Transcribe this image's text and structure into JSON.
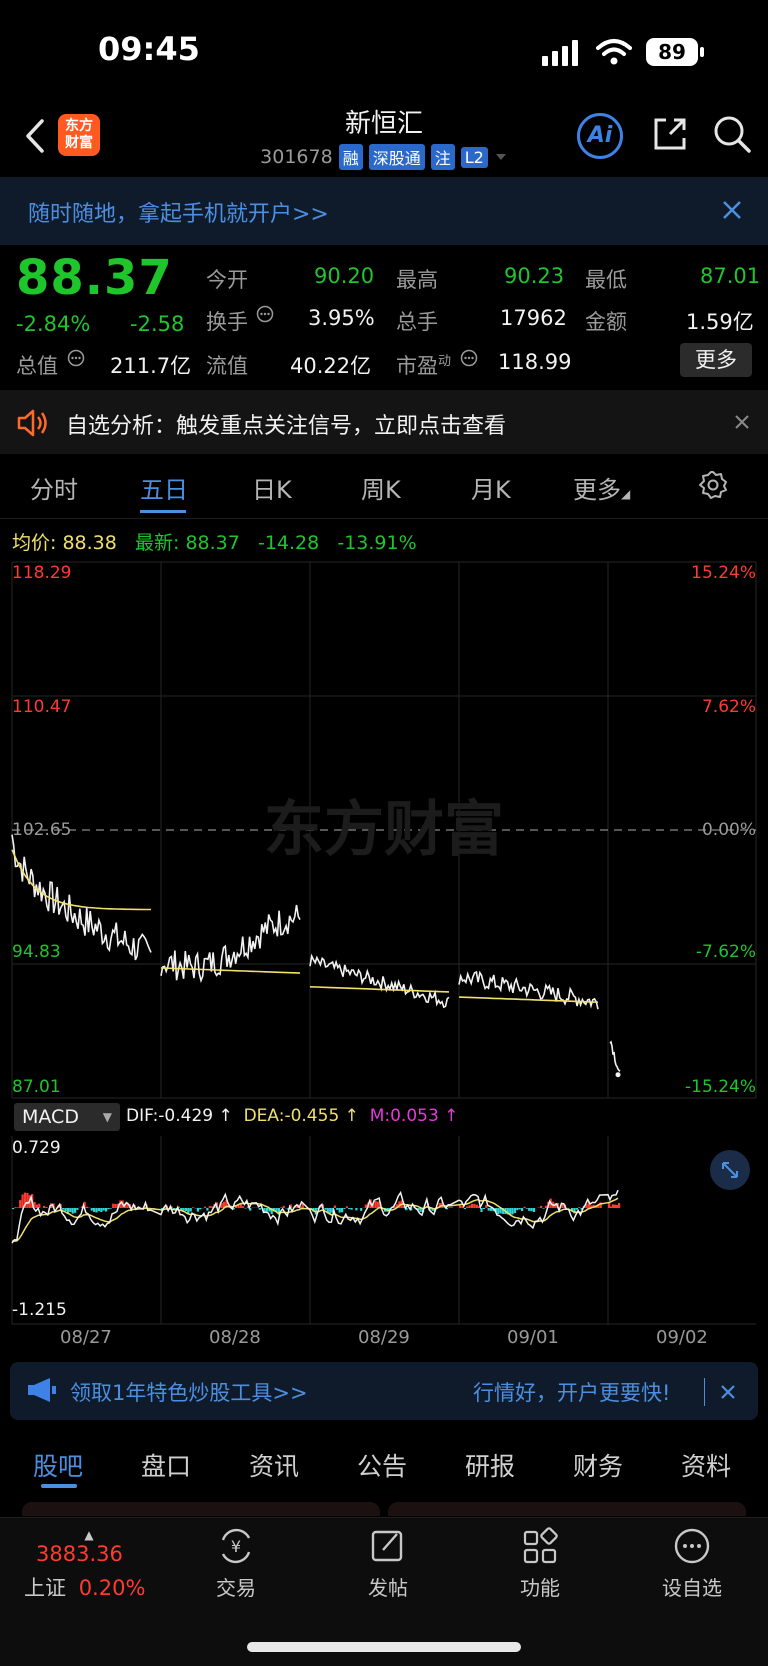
{
  "status": {
    "time": "09:45",
    "battery": "89"
  },
  "nav": {
    "logo_line1": "东方",
    "logo_line2": "财富",
    "stock_name": "新恒汇",
    "stock_code": "301678",
    "tags": [
      "融",
      "深股通",
      "注",
      "L2"
    ],
    "ai_label": "Ai"
  },
  "banner": {
    "text": "随时随地，拿起手机就开户>>"
  },
  "quote": {
    "price": "88.37",
    "change_pct": "-2.84%",
    "change_abs": "-2.58",
    "open_label": "今开",
    "open_value": "90.20",
    "high_label": "最高",
    "high_value": "90.23",
    "low_label": "最低",
    "low_value": "87.01",
    "turnover_label": "换手",
    "turnover_value": "3.95%",
    "volume_label": "总手",
    "volume_value": "17962",
    "amount_label": "金额",
    "amount_value": "1.59亿",
    "total_mv_label": "总值",
    "total_mv_value": "211.7亿",
    "float_mv_label": "流值",
    "float_mv_value": "40.22亿",
    "pe_label": "市盈",
    "pe_sup": "动",
    "pe_value": "118.99",
    "more_label": "更多"
  },
  "analysis": {
    "text": "自选分析：触发重点关注信号，立即点击查看"
  },
  "tabs": [
    "分时",
    "五日",
    "日K",
    "周K",
    "月K",
    "更多"
  ],
  "legend": {
    "avg_label": "均价:",
    "avg_value": "88.38",
    "latest_label": "最新:",
    "latest_value": "88.37",
    "change_abs": "-14.28",
    "change_pct": "-13.91%"
  },
  "chart": {
    "y_left": [
      "118.29",
      "110.47",
      "102.65",
      "94.83",
      "87.01"
    ],
    "y_right": [
      "15.24%",
      "7.62%",
      "0.00%",
      "-7.62%",
      "-15.24%"
    ],
    "watermark": "东方财富",
    "macd_label": "MACD",
    "dif": "DIF:-0.429 ↑",
    "dea": "DEA:-0.455 ↑",
    "m": "M:0.053 ↑",
    "macd_max": "0.729",
    "macd_min": "-1.215",
    "dates": [
      "08/27",
      "08/28",
      "08/29",
      "09/01",
      "09/02"
    ]
  },
  "chart_data": {
    "type": "line",
    "x": [
      "08/27",
      "08/28",
      "08/29",
      "09/01",
      "09/02"
    ],
    "ylim": [
      87.01,
      118.29
    ],
    "reference": 102.65,
    "series": [
      {
        "name": "",
        "values": [
          102.1,
          96.5,
          94.2,
          92.8,
          88.37
        ]
      },
      {
        "name": "均价",
        "values": [
          98.0,
          94.3,
          93.2,
          92.6,
          88.38
        ]
      }
    ]
  },
  "promo": {
    "left_text": "领取1年特色炒股工具>>",
    "right_text": "行情好，开户更要快!"
  },
  "bottom_tabs": [
    "股吧",
    "盘口",
    "资讯",
    "公告",
    "研报",
    "财务",
    "资料"
  ],
  "bottom_nav": {
    "index_value": "3883.36",
    "index_name": "上证",
    "index_change": "0.20%",
    "trade": "交易",
    "post": "发帖",
    "function": "功能",
    "watchlist": "设自选"
  },
  "colors": {
    "up": "#ff3b30",
    "down": "#1ec52b",
    "accent": "#4c8fe0",
    "avg": "#f0e06a"
  }
}
